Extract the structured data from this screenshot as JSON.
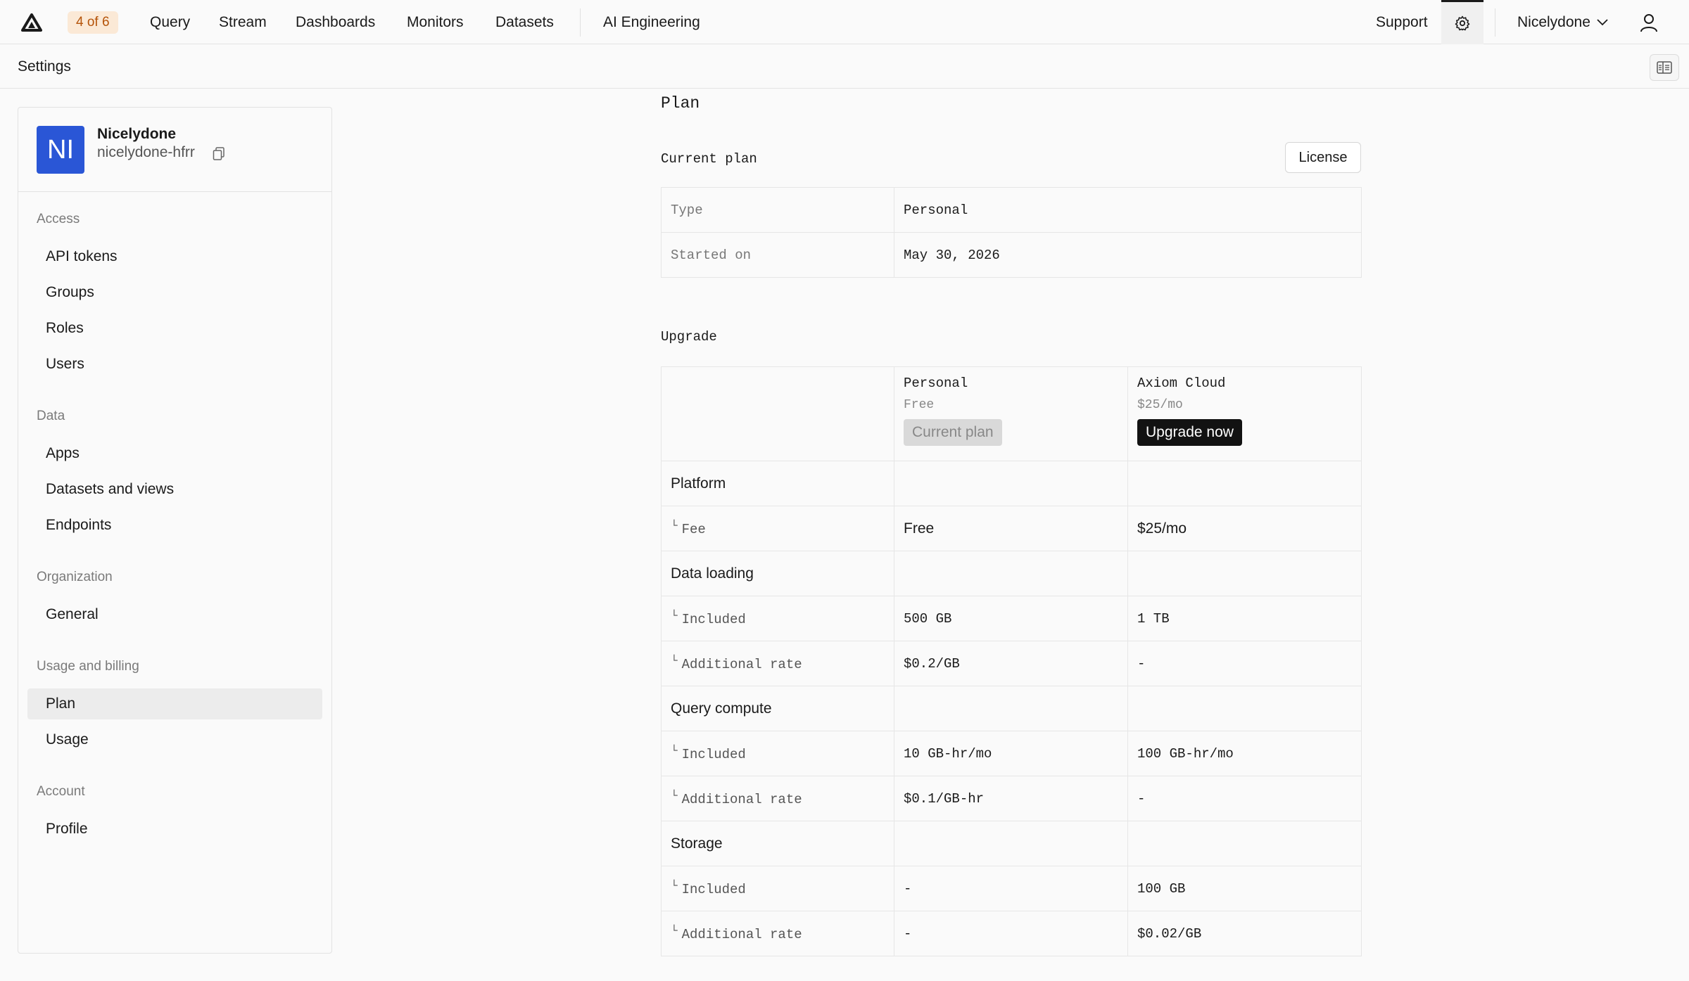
{
  "topnav": {
    "badge": "4 of 6",
    "items": [
      "Query",
      "Stream",
      "Dashboards",
      "Monitors",
      "Datasets"
    ],
    "ai": "AI Engineering",
    "support": "Support",
    "user": "Nicelydone"
  },
  "settings_bar": {
    "title": "Settings"
  },
  "org": {
    "initials": "NI",
    "name": "Nicelydone",
    "slug": "nicelydone-hfrr"
  },
  "sidebar": {
    "access": {
      "title": "Access",
      "items": [
        "API tokens",
        "Groups",
        "Roles",
        "Users"
      ]
    },
    "data": {
      "title": "Data",
      "items": [
        "Apps",
        "Datasets and views",
        "Endpoints"
      ]
    },
    "organization": {
      "title": "Organization",
      "items": [
        "General"
      ]
    },
    "billing": {
      "title": "Usage and billing",
      "items": [
        "Plan",
        "Usage"
      ]
    },
    "account": {
      "title": "Account",
      "items": [
        "Profile"
      ]
    }
  },
  "main": {
    "heading": "Plan",
    "current_plan": {
      "title": "Current plan",
      "license_button": "License",
      "rows": [
        {
          "label": "Type",
          "value": "Personal"
        },
        {
          "label": "Started on",
          "value": "May 30, 2026"
        }
      ]
    },
    "upgrade": {
      "title": "Upgrade",
      "plans": [
        {
          "name": "Personal",
          "price": "Free",
          "button": "Current plan"
        },
        {
          "name": "Axiom Cloud",
          "price": "$25/mo",
          "button": "Upgrade now"
        }
      ],
      "groups": {
        "platform": "Platform",
        "data_loading": "Data loading",
        "query_compute": "Query compute",
        "storage": "Storage"
      },
      "rows": {
        "fee": {
          "label": "Fee",
          "personal": "Free",
          "cloud": "$25/mo"
        },
        "dl_included": {
          "label": "Included",
          "personal": "500 GB",
          "cloud": "1 TB"
        },
        "dl_rate": {
          "label": "Additional rate",
          "personal": "$0.2/GB",
          "cloud": "-"
        },
        "qc_included": {
          "label": "Included",
          "personal": "10 GB-hr/mo",
          "cloud": "100 GB-hr/mo"
        },
        "qc_rate": {
          "label": "Additional rate",
          "personal": "$0.1/GB-hr",
          "cloud": "-"
        },
        "st_included": {
          "label": "Included",
          "personal": "-",
          "cloud": "100 GB"
        },
        "st_rate": {
          "label": "Additional rate",
          "personal": "-",
          "cloud": "$0.02/GB"
        }
      },
      "corner_glyph": "└"
    }
  }
}
